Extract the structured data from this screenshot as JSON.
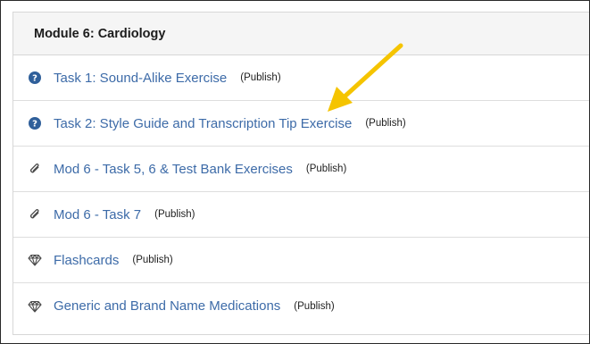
{
  "module": {
    "title": "Module 6: Cardiology",
    "items": [
      {
        "label": "Task 1: Sound-Alike Exercise",
        "publish": "(Publish)",
        "icon": "question-circle-icon"
      },
      {
        "label": "Task 2: Style Guide and Transcription Tip Exercise",
        "publish": "(Publish)",
        "icon": "question-circle-icon"
      },
      {
        "label": "Mod 6 - Task 5, 6 & Test Bank Exercises",
        "publish": "(Publish)",
        "icon": "paperclip-icon"
      },
      {
        "label": "Mod 6 - Task 7",
        "publish": "(Publish)",
        "icon": "paperclip-icon"
      },
      {
        "label": "Flashcards",
        "publish": "(Publish)",
        "icon": "diamond-icon"
      },
      {
        "label": "Generic and Brand Name Medications",
        "publish": "(Publish)",
        "icon": "diamond-icon"
      }
    ]
  },
  "colors": {
    "link": "#3d6ba8",
    "icon": "#2f5f9a",
    "annotation_arrow": "#f5c400"
  }
}
